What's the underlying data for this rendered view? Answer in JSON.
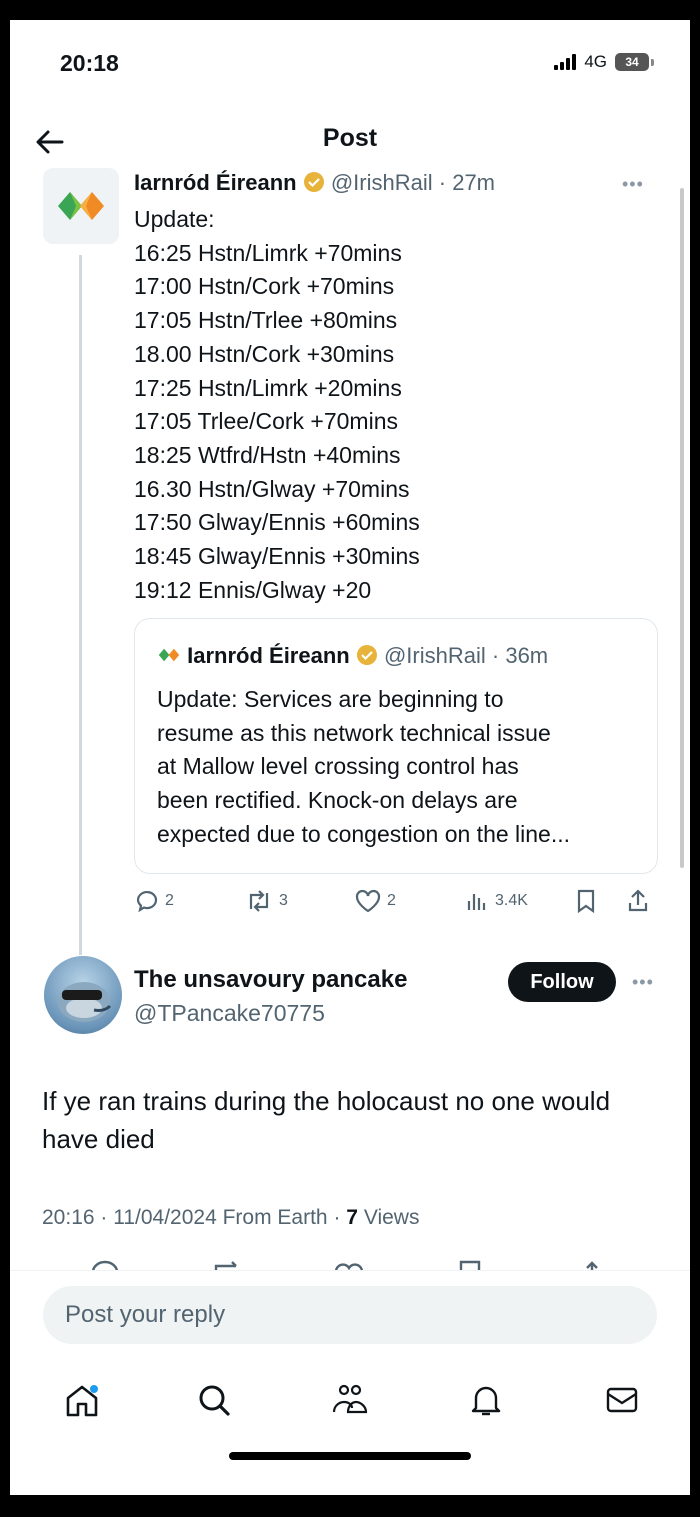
{
  "status_bar": {
    "time": "20:18",
    "network": "4G",
    "battery": "34"
  },
  "header": {
    "title": "Post"
  },
  "post": {
    "author_name": "Iarnród Éireann",
    "author_handle": "@IrishRail",
    "time_ago": "· 27m",
    "lines": [
      "Update:",
      "16:25 Hstn/Limrk +70mins",
      "17:00 Hstn/Cork +70mins",
      "17:05 Hstn/Trlee +80mins",
      "18.00 Hstn/Cork +30mins",
      "17:25 Hstn/Limrk +20mins",
      "17:05 Trlee/Cork +70mins",
      "18:25 Wtfrd/Hstn +40mins",
      "16.30 Hstn/Glway +70mins",
      "17:50 Glway/Ennis +60mins",
      "18:45 Glway/Ennis +30mins",
      "19:12 Ennis/Glway +20"
    ],
    "quote": {
      "author_name": "Iarnród Éireann",
      "author_handle": "@IrishRail",
      "time_ago": "· 36m",
      "lines": [
        "Update: Services are beginning to",
        "resume as this network technical issue",
        "at Mallow level crossing control has",
        "been rectified. Knock-on delays are",
        "expected due to congestion on the line..."
      ]
    },
    "actions": {
      "replies": "2",
      "reposts": "3",
      "likes": "2",
      "views": "3.4K"
    }
  },
  "reply": {
    "author_name": "The unsavoury pancake",
    "author_handle": "@TPancake70775",
    "follow_label": "Follow",
    "body": "If ye ran trains during the holocaust no one would have died",
    "meta_prefix": "20:16 · 11/04/2024 From Earth · ",
    "views_count": "7",
    "views_label": "Views"
  },
  "composer": {
    "placeholder": "Post your reply"
  },
  "nav": [
    "home-icon",
    "search-icon",
    "communities-icon",
    "notifications-icon",
    "messages-icon"
  ],
  "colors": {
    "text": "#0f1419",
    "secondary": "#536471",
    "verified": "#e8b33a",
    "brand_green": "#3aa655",
    "brand_orange": "#f08a24"
  }
}
